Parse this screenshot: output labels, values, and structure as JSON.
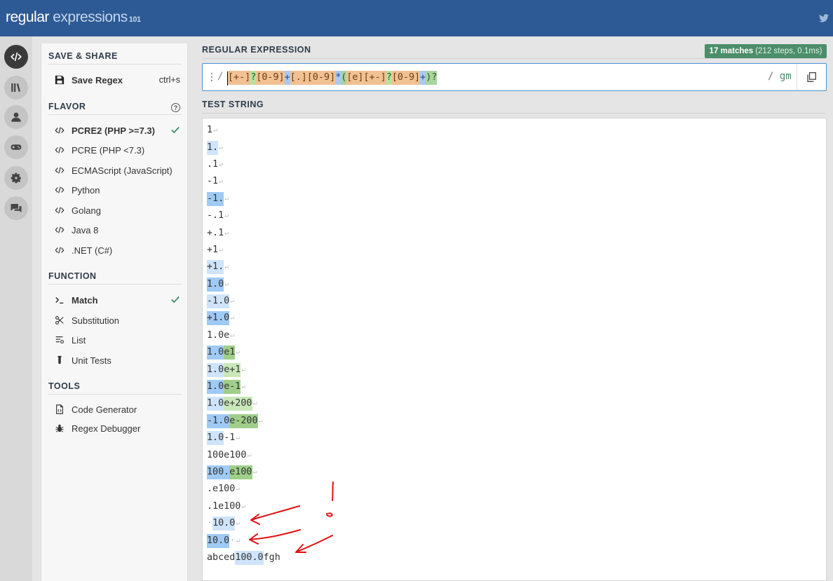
{
  "header": {
    "logo_part1": "regular",
    "logo_part2": " expressions",
    "logo_part3": "101"
  },
  "rail": {
    "icons": [
      "code-icon",
      "library-icon",
      "account-icon",
      "quiz-icon",
      "settings-icon",
      "chat-icon"
    ]
  },
  "sidebar": {
    "save_share": {
      "title": "SAVE & SHARE",
      "save_label": "Save Regex",
      "save_shortcut": "ctrl+s"
    },
    "flavor": {
      "title": "FLAVOR",
      "help_glyph": "?",
      "items": [
        {
          "label": "PCRE2 (PHP >=7.3)",
          "selected": true
        },
        {
          "label": "PCRE (PHP <7.3)",
          "selected": false
        },
        {
          "label": "ECMAScript (JavaScript)",
          "selected": false
        },
        {
          "label": "Python",
          "selected": false
        },
        {
          "label": "Golang",
          "selected": false
        },
        {
          "label": "Java 8",
          "selected": false
        },
        {
          "label": ".NET (C#)",
          "selected": false
        }
      ]
    },
    "function": {
      "title": "FUNCTION",
      "items": [
        {
          "label": "Match",
          "selected": true,
          "icon": "terminal-icon"
        },
        {
          "label": "Substitution",
          "selected": false,
          "icon": "scissors-icon"
        },
        {
          "label": "List",
          "selected": false,
          "icon": "list-icon"
        },
        {
          "label": "Unit Tests",
          "selected": false,
          "icon": "test-tube-icon"
        }
      ]
    },
    "tools": {
      "title": "TOOLS",
      "items": [
        {
          "label": "Code Generator",
          "icon": "file-code-icon"
        },
        {
          "label": "Regex Debugger",
          "icon": "bug-icon"
        }
      ]
    }
  },
  "main": {
    "regex_title": "REGULAR EXPRESSION",
    "match_count": "17 matches",
    "match_info": "(212 steps, 0.1ms)",
    "delimiter_open": "/",
    "delimiter_close": "/",
    "flags": "gm",
    "regex_tokens": [
      {
        "text": "[+-]",
        "type": "cls"
      },
      {
        "text": "?",
        "type": "q"
      },
      {
        "text": "[0-9]",
        "type": "cls"
      },
      {
        "text": "+",
        "type": "quant"
      },
      {
        "text": "[.]",
        "type": "cls"
      },
      {
        "text": "[0-9]",
        "type": "cls"
      },
      {
        "text": "*",
        "type": "quant"
      },
      {
        "text": "(",
        "type": "grp"
      },
      {
        "text": "[e]",
        "type": "cls"
      },
      {
        "text": "[+-]",
        "type": "cls"
      },
      {
        "text": "?",
        "type": "q"
      },
      {
        "text": "[0-9]",
        "type": "cls"
      },
      {
        "text": "+",
        "type": "quant"
      },
      {
        "text": ")?",
        "type": "grp"
      }
    ],
    "test_title": "TEST STRING",
    "test_lines": [
      [
        {
          "t": "1"
        }
      ],
      [
        {
          "t": "1.",
          "c": "m1"
        }
      ],
      [
        {
          "t": ".1"
        }
      ],
      [
        {
          "t": "-1"
        }
      ],
      [
        {
          "t": "-1.",
          "c": "m2"
        }
      ],
      [
        {
          "t": "-.1"
        }
      ],
      [
        {
          "t": "+.1"
        }
      ],
      [
        {
          "t": "+1"
        }
      ],
      [
        {
          "t": "+1.",
          "c": "m1"
        }
      ],
      [
        {
          "t": "1.0",
          "c": "m2"
        }
      ],
      [
        {
          "t": "-1.0",
          "c": "m1"
        }
      ],
      [
        {
          "t": "+1.0",
          "c": "m2"
        }
      ],
      [
        {
          "t": "1.0e"
        }
      ],
      [
        {
          "t": "1.0",
          "c": "m2"
        },
        {
          "t": "e1",
          "c": "g2"
        }
      ],
      [
        {
          "t": "1.0",
          "c": "m1"
        },
        {
          "t": "e+1",
          "c": "g1"
        }
      ],
      [
        {
          "t": "1.0",
          "c": "m2"
        },
        {
          "t": "e-1",
          "c": "g2"
        }
      ],
      [
        {
          "t": "1.0",
          "c": "m1"
        },
        {
          "t": "e+200",
          "c": "g1"
        }
      ],
      [
        {
          "t": "-1.0",
          "c": "m2"
        },
        {
          "t": "e-200",
          "c": "g2"
        }
      ],
      [
        {
          "t": "1.0",
          "c": "m1"
        },
        {
          "t": "-1"
        }
      ],
      [
        {
          "t": "100e100"
        }
      ],
      [
        {
          "t": "100.",
          "c": "m2"
        },
        {
          "t": "e100",
          "c": "g2"
        }
      ],
      [
        {
          "t": ".e100"
        }
      ],
      [
        {
          "t": ".1e100"
        }
      ],
      [
        {
          "t": "·",
          "c": "dot"
        },
        {
          "t": "10.0",
          "c": "m1"
        }
      ],
      [
        {
          "t": "10.0",
          "c": "m2"
        },
        {
          "t": "·",
          "c": "dot"
        }
      ],
      [
        {
          "t": "abced"
        },
        {
          "t": "100.0",
          "c": "m1"
        },
        {
          "t": "fgh",
          "nonl": true
        }
      ]
    ]
  }
}
